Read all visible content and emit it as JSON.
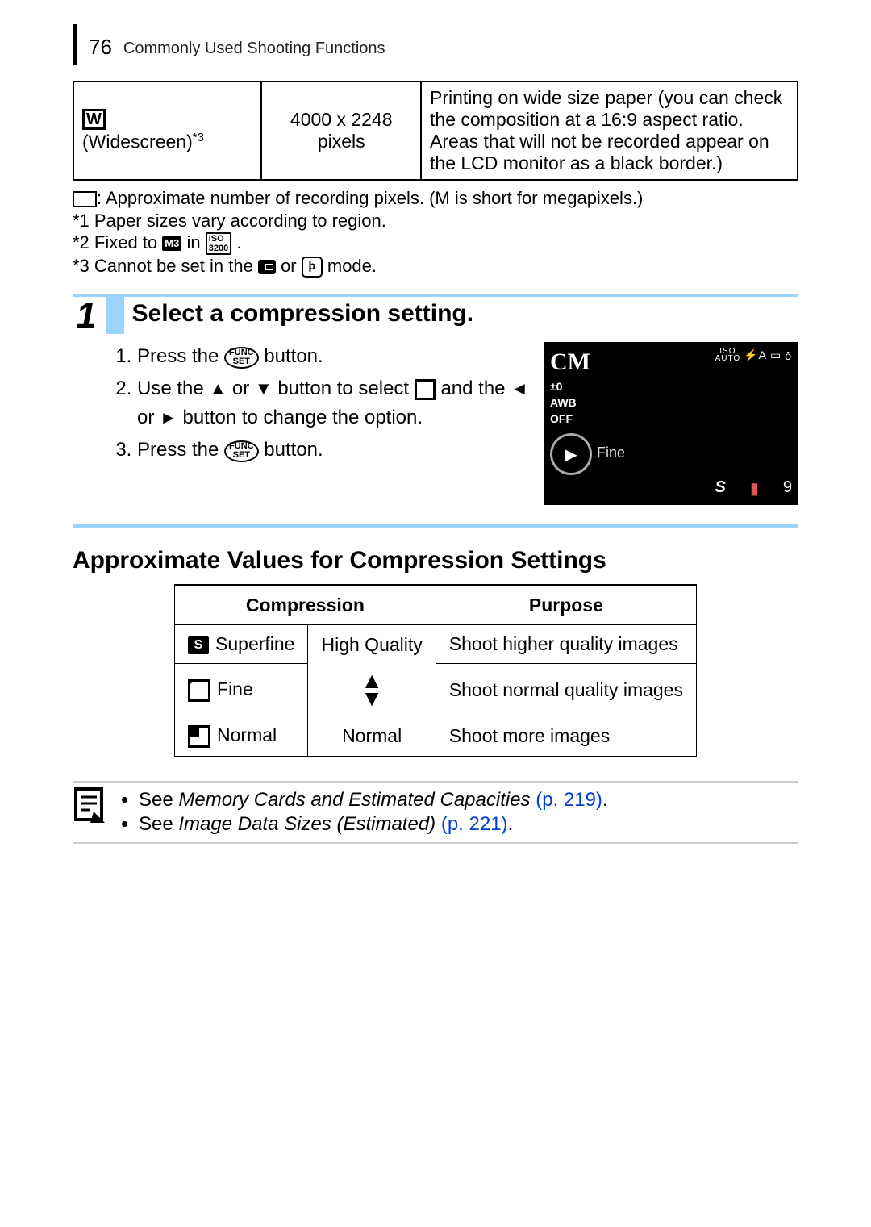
{
  "header": {
    "page_number": "76",
    "section": "Commonly Used Shooting Functions"
  },
  "widescreen_table": {
    "icon_text": "W",
    "label": "(Widescreen)",
    "note_ref": "*3",
    "resolution": "4000 x 2248",
    "resolution_unit": "pixels",
    "description": "Printing on wide size paper (you can check the composition at a 16:9 aspect ratio. Areas that will not be recorded appear on the LCD monitor as a black border.)"
  },
  "footnotes": {
    "pixel_note": ": Approximate number of recording pixels. (M is short for megapixels.)",
    "f1": "*1 Paper sizes vary according to region.",
    "f2a": "*2 Fixed to ",
    "f2_icon1": "M3",
    "f2b": " in ",
    "f2_icon2_top": "ISO",
    "f2_icon2_bot": "3200",
    "f2c": ".",
    "f3a": "*3 Cannot be set in the ",
    "f3b": " or ",
    "f3c": " mode.",
    "mode_p": "þ"
  },
  "step1": {
    "number": "1",
    "title": "Select a compression setting.",
    "items": {
      "a1": "Press the ",
      "func": "FUNC",
      "set": "SET",
      "a2": " button.",
      "b1": "Use the ",
      "up": "▲",
      "or": " or ",
      "down": "▼",
      "b2": " button to select ",
      "b3": " and the ",
      "left": "◄",
      "right": "►",
      "b4": " button to change the option.",
      "c1": "Press the ",
      "c2": " button."
    }
  },
  "lcd": {
    "cm": "CM",
    "iso": "ISO",
    "auto": "AUTO",
    "flash": "⚡A",
    "rect": "▭",
    "timer": "ô",
    "ev": "±0",
    "awb": "AWB",
    "off": "OFF",
    "dial": "▶",
    "label": "Fine",
    "b1": "S",
    "b2": "▮",
    "b3": "9"
  },
  "section2_title": "Approximate Values for Compression Settings",
  "ctable": {
    "h1": "Compression",
    "h2": "Purpose",
    "r1_label": "Superfine",
    "r1_q": "High Quality",
    "r1_p": "Shoot higher quality images",
    "r2_label": "Fine",
    "r2_p": "Shoot normal quality images",
    "r3_label": "Normal",
    "r3_q": "Normal",
    "r3_p": "Shoot more images"
  },
  "seealso": {
    "s1a": "See ",
    "s1b": "Memory Cards and Estimated Capacities",
    "s1c": " (p. 219)",
    "s1d": ".",
    "s2a": "See ",
    "s2b": "Image Data Sizes (Estimated)",
    "s2c": " (p. 221)",
    "s2d": "."
  }
}
